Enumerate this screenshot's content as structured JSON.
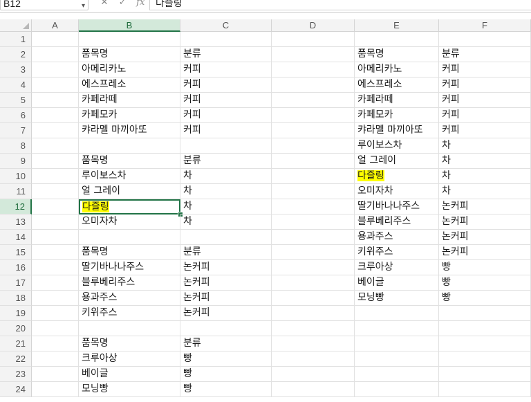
{
  "formula_bar": {
    "name_box": "B12",
    "formula": "다즐링",
    "cancel_icon": "✕",
    "confirm_icon": "✓",
    "fx_label": "fx"
  },
  "columns": [
    "A",
    "B",
    "C",
    "D",
    "E",
    "F"
  ],
  "rows": [
    "1",
    "2",
    "3",
    "4",
    "5",
    "6",
    "7",
    "8",
    "9",
    "10",
    "11",
    "12",
    "13",
    "14",
    "15",
    "16",
    "17",
    "18",
    "19",
    "20",
    "21",
    "22",
    "23",
    "24"
  ],
  "selected": {
    "row": 12,
    "col": "B"
  },
  "colors": {
    "accent": "#217346",
    "highlight": "#ffff00"
  },
  "cells": {
    "B2": "품목명",
    "C2": "분류",
    "B3": "아메리카노",
    "C3": "커피",
    "B4": "에스프레소",
    "C4": "커피",
    "B5": "카페라떼",
    "C5": "커피",
    "B6": "카페모카",
    "C6": "커피",
    "B7": "캬라멜 마끼아또",
    "C7": "커피",
    "B9": "품목명",
    "C9": "분류",
    "B10": "루이보스차",
    "C10": "차",
    "B11": "얼 그레이",
    "C11": "차",
    "B12": "다즐링",
    "C12": "차",
    "B13": "오미자차",
    "C13": "차",
    "B15": "품목명",
    "C15": "분류",
    "B16": "딸기바나나주스",
    "C16": "논커피",
    "B17": "블루베리주스",
    "C17": "논커피",
    "B18": "용과주스",
    "C18": "논커피",
    "B19": "키위주스",
    "C19": "논커피",
    "B21": "품목명",
    "C21": "분류",
    "B22": "크루아상",
    "C22": "빵",
    "B23": "베이글",
    "C23": "빵",
    "B24": "모닝빵",
    "C24": "빵",
    "E2": "품목명",
    "F2": "분류",
    "E3": "아메리카노",
    "F3": "커피",
    "E4": "에스프레소",
    "F4": "커피",
    "E5": "카페라떼",
    "F5": "커피",
    "E6": "카페모카",
    "F6": "커피",
    "E7": "캬라멜 마끼아또",
    "F7": "커피",
    "E8": "루이보스차",
    "F8": "차",
    "E9": "얼 그레이",
    "F9": "차",
    "E10": "다즐링",
    "F10": "차",
    "E11": "오미자차",
    "F11": "차",
    "E12": "딸기바나나주스",
    "F12": "논커피",
    "E13": "블루베리주스",
    "F13": "논커피",
    "E14": "용과주스",
    "F14": "논커피",
    "E15": "키위주스",
    "F15": "논커피",
    "E16": "크루아상",
    "F16": "빵",
    "E17": "베이글",
    "F17": "빵",
    "E18": "모닝빵",
    "F18": "빵"
  },
  "highlighted_cells": [
    "B12",
    "E10"
  ]
}
